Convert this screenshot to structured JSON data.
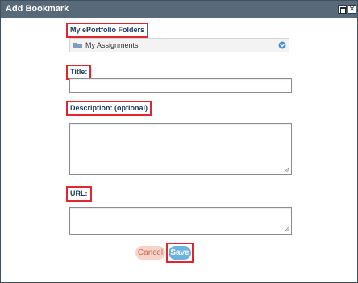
{
  "dialog": {
    "title": "Add Bookmark"
  },
  "titlebar_icons": {
    "maximize": "maximize-icon",
    "close": "close-icon"
  },
  "form": {
    "folders_label": "My ePortfolio Folders",
    "folder_selected": "My Assignments",
    "folder_icon": "folder-icon",
    "dropdown_icon": "chevron-down-circle-icon",
    "title_label": "Title:",
    "title_value": "",
    "description_label": "Description: (optional)",
    "description_value": "",
    "url_label": "URL:",
    "url_value": ""
  },
  "buttons": {
    "cancel_label": "Cancel",
    "save_label": "Save"
  },
  "colors": {
    "titlebar": "#586a7a",
    "label_text": "#1b3a5c",
    "highlight_border": "#e0262e",
    "save_button": "#6cb2de",
    "cancel_button": "#f8d3c9",
    "cancel_text": "#c8694e",
    "dropdown_icon": "#4a8fd6",
    "folder_icon": "#7d9cc4"
  }
}
